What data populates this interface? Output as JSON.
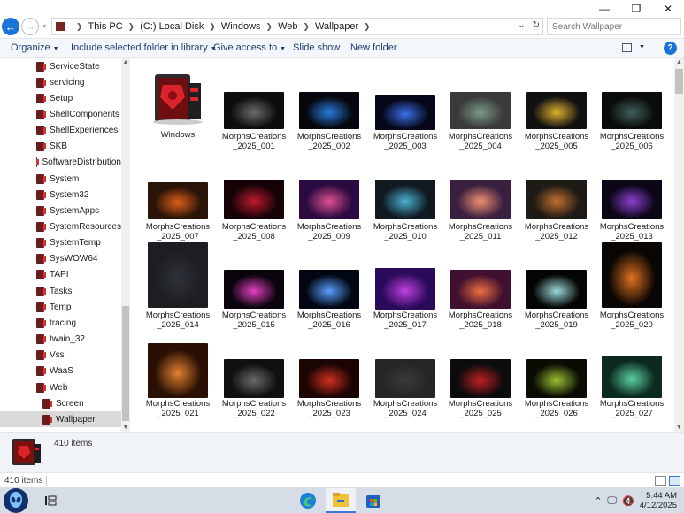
{
  "window": {
    "minimize": "—",
    "maximize": "❐",
    "close": "✕"
  },
  "address": {
    "crumbs": [
      "This PC",
      "(C:) Local Disk",
      "Windows",
      "Web",
      "Wallpaper"
    ],
    "search_placeholder": "Search Wallpaper"
  },
  "commands": {
    "organize": "Organize",
    "include": "Include selected folder in library",
    "give_access": "Give access to",
    "slide_show": "Slide show",
    "new_folder": "New folder",
    "help": "?"
  },
  "sidebar": {
    "items": [
      {
        "label": "ServiceState",
        "indent": 1
      },
      {
        "label": "servicing",
        "indent": 1
      },
      {
        "label": "Setup",
        "indent": 1
      },
      {
        "label": "ShellComponents",
        "indent": 1
      },
      {
        "label": "ShellExperiences",
        "indent": 1
      },
      {
        "label": "SKB",
        "indent": 1
      },
      {
        "label": "SoftwareDistribution",
        "indent": 1
      },
      {
        "label": "System",
        "indent": 1
      },
      {
        "label": "System32",
        "indent": 1
      },
      {
        "label": "SystemApps",
        "indent": 1
      },
      {
        "label": "SystemResources",
        "indent": 1
      },
      {
        "label": "SystemTemp",
        "indent": 1
      },
      {
        "label": "SysWOW64",
        "indent": 1
      },
      {
        "label": "TAPI",
        "indent": 1
      },
      {
        "label": "Tasks",
        "indent": 1
      },
      {
        "label": "Temp",
        "indent": 1
      },
      {
        "label": "tracing",
        "indent": 1
      },
      {
        "label": "twain_32",
        "indent": 1
      },
      {
        "label": "Vss",
        "indent": 1
      },
      {
        "label": "WaaS",
        "indent": 1
      },
      {
        "label": "Web",
        "indent": 1
      },
      {
        "label": "Screen",
        "indent": 2
      },
      {
        "label": "Wallpaper",
        "indent": 2,
        "selected": true
      }
    ]
  },
  "files": [
    {
      "name": "Windows",
      "folder": true
    },
    {
      "name": "MorphsCreations_2025_001",
      "bg": "#0d0d0d",
      "accent": "#6b6b6b"
    },
    {
      "name": "MorphsCreations_2025_002",
      "bg": "#05070d",
      "accent": "#2a7be0"
    },
    {
      "name": "MorphsCreations_2025_003",
      "bg": "#06081a",
      "accent": "#3a6fe8"
    },
    {
      "name": "MorphsCreations_2025_004",
      "bg": "#3a3a3a",
      "accent": "#7a9a86"
    },
    {
      "name": "MorphsCreations_2025_005",
      "bg": "#111111",
      "accent": "#e0b030"
    },
    {
      "name": "MorphsCreations_2025_006",
      "bg": "#0a0c0c",
      "accent": "#3f5f5a"
    },
    {
      "name": "MorphsCreations_2025_007",
      "bg": "#2a1408",
      "accent": "#e0601a"
    },
    {
      "name": "MorphsCreations_2025_008",
      "bg": "#160306",
      "accent": "#c01a30"
    },
    {
      "name": "MorphsCreations_2025_009",
      "bg": "#2a0a40",
      "accent": "#e05090"
    },
    {
      "name": "MorphsCreations_2025_010",
      "bg": "#101820",
      "accent": "#4ab0d0"
    },
    {
      "name": "MorphsCreations_2025_011",
      "bg": "#3a2040",
      "accent": "#f09070"
    },
    {
      "name": "MorphsCreations_2025_012",
      "bg": "#1e1a16",
      "accent": "#c07030"
    },
    {
      "name": "MorphsCreations_2025_013",
      "bg": "#0c0618",
      "accent": "#8a40d0"
    },
    {
      "name": "MorphsCreations_2025_014",
      "bg": "#1c1e22",
      "accent": "#2e3238"
    },
    {
      "name": "MorphsCreations_2025_015",
      "bg": "#0a040c",
      "accent": "#e040c0"
    },
    {
      "name": "MorphsCreations_2025_016",
      "bg": "#020612",
      "accent": "#5aa0ff"
    },
    {
      "name": "MorphsCreations_2025_017",
      "bg": "#2a0a5a",
      "accent": "#c040e0"
    },
    {
      "name": "MorphsCreations_2025_018",
      "bg": "#401030",
      "accent": "#f07040"
    },
    {
      "name": "MorphsCreations_2025_019",
      "bg": "#050505",
      "accent": "#9adada"
    },
    {
      "name": "MorphsCreations_2025_020",
      "bg": "#0a0604",
      "accent": "#e07020"
    },
    {
      "name": "MorphsCreations_2025_021",
      "bg": "#2a1004",
      "accent": "#e08030"
    },
    {
      "name": "MorphsCreations_2025_022",
      "bg": "#101010",
      "accent": "#6a6a6a"
    },
    {
      "name": "MorphsCreations_2025_023",
      "bg": "#1a0404",
      "accent": "#d03020"
    },
    {
      "name": "MorphsCreations_2025_024",
      "bg": "#262626",
      "accent": "#3a3a3a"
    },
    {
      "name": "MorphsCreations_2025_025",
      "bg": "#0c0c0e",
      "accent": "#c02020"
    },
    {
      "name": "MorphsCreations_2025_026",
      "bg": "#0a0c04",
      "accent": "#9ac030"
    },
    {
      "name": "MorphsCreations_2025_027",
      "bg": "#0c2a20",
      "accent": "#5ad0a0"
    }
  ],
  "details": {
    "count": "410 items"
  },
  "status": {
    "count": "410 items"
  },
  "taskbar": {
    "time": "5:44 AM",
    "date": "4/12/2025"
  }
}
